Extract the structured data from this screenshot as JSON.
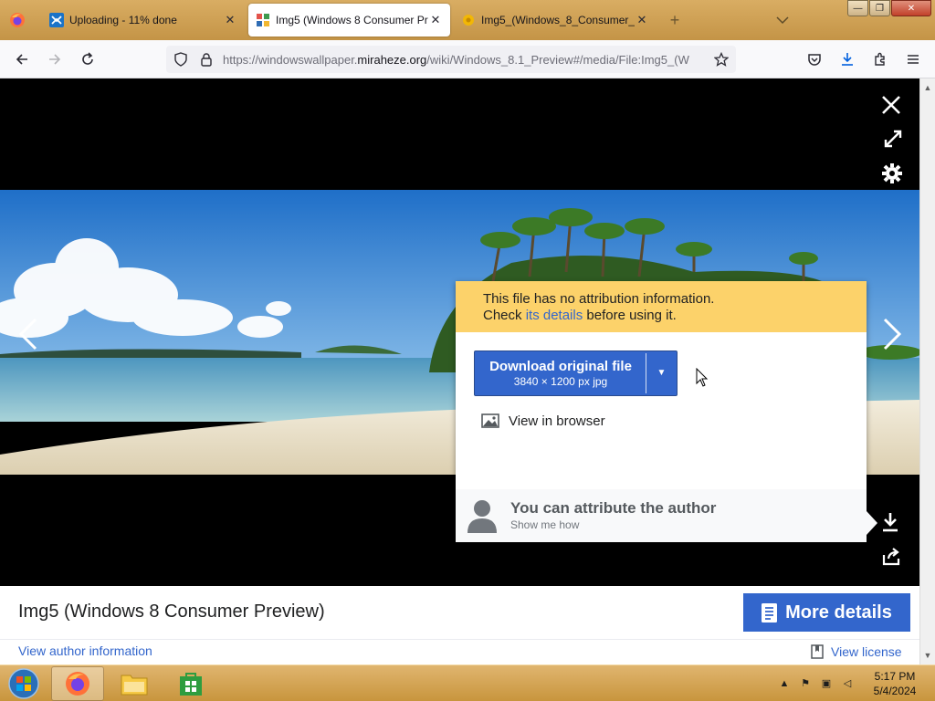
{
  "browser": {
    "tabs": [
      {
        "title": "Uploading - 11% done",
        "close": "✕"
      },
      {
        "title": "Img5 (Windows 8 Consumer Pr",
        "close": "✕"
      },
      {
        "title": "Img5_(Windows_8_Consumer_",
        "close": "✕"
      }
    ],
    "new_tab": "+",
    "window_buttons": {
      "minimize": "—",
      "restore": "❐",
      "close": "✕"
    }
  },
  "navbar": {
    "url_prefix": "https://windowswallpaper.",
    "url_domain": "miraheze.org",
    "url_rest": "/wiki/Windows_8.1_Preview#/media/File:Img5_(W"
  },
  "popup": {
    "warning_line1": "This file has no attribution information.",
    "warning_line2_pre": "Check ",
    "warning_link": "its details",
    "warning_line2_post": " before using it.",
    "download_label": "Download original file",
    "download_meta": "3840 × 1200 px jpg",
    "download_caret": "▼",
    "view_in_browser": "View in browser",
    "attribute_title": "You can attribute the author",
    "attribute_sub": "Show me how"
  },
  "viewer": {
    "prev": "‹",
    "next": "›"
  },
  "info": {
    "title": "Img5 (Windows 8 Consumer Preview)",
    "more_details": "More details",
    "author_link": "View author information",
    "license_link": "View license"
  },
  "taskbar": {
    "time": "5:17 PM",
    "date": "5/4/2024"
  },
  "colors": {
    "accent": "#3366cc",
    "warning": "#fcd26a",
    "taskbar": "#c8953d"
  }
}
